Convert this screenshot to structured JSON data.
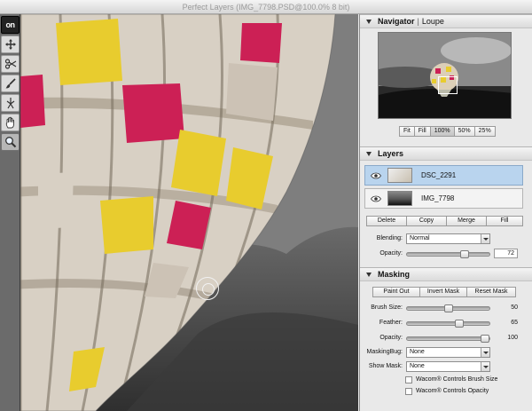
{
  "window": {
    "title": "Perfect Layers (IMG_7798.PSD@100.0% 8 bit)"
  },
  "toolbar": {
    "logo": "on",
    "tools": [
      "move-tool",
      "scissors-tool",
      "brush-tool",
      "retouch-tool",
      "hand-tool",
      "zoom-tool"
    ]
  },
  "navigator": {
    "title": "Navigator",
    "separator": "|",
    "loupe_label": "Loupe",
    "zoom_buttons": [
      "Fit",
      "Fill",
      "100%",
      "50%",
      "25%"
    ],
    "selected_zoom": "100%"
  },
  "layers": {
    "title": "Layers",
    "items": [
      {
        "name": "DSC_2291",
        "selected": true
      },
      {
        "name": "IMG_7798",
        "selected": false
      }
    ],
    "actions": [
      "Delete",
      "Copy",
      "Merge",
      "Fill"
    ],
    "blending_label": "Blending:",
    "blending_value": "Normal",
    "opacity_label": "Opacity:",
    "opacity_value": "72",
    "opacity_level": 0.72
  },
  "masking": {
    "title": "Masking",
    "actions": [
      "Paint Out",
      "Invert Mask",
      "Reset Mask"
    ],
    "brush_size_label": "Brush Size:",
    "brush_size_value": "50",
    "brush_size_level": 0.5,
    "feather_label": "Feather:",
    "feather_value": "65",
    "feather_level": 0.65,
    "opacity_label": "Opacity:",
    "opacity_value": "100",
    "opacity_level": 1.0,
    "maskingbug_label": "MaskingBug:",
    "maskingbug_value": "None",
    "show_mask_label": "Show Mask:",
    "show_mask_value": "None",
    "wacom_brush_size_label": "Wacom® Controls Brush Size",
    "wacom_opacity_label": "Wacom® Controls Opacity"
  },
  "colors": {
    "selected_layer": "#b9d4ee",
    "balloon_yellow": "#e8cc2e",
    "balloon_magenta": "#cc2055",
    "balloon_cream": "#ddd6cc"
  }
}
